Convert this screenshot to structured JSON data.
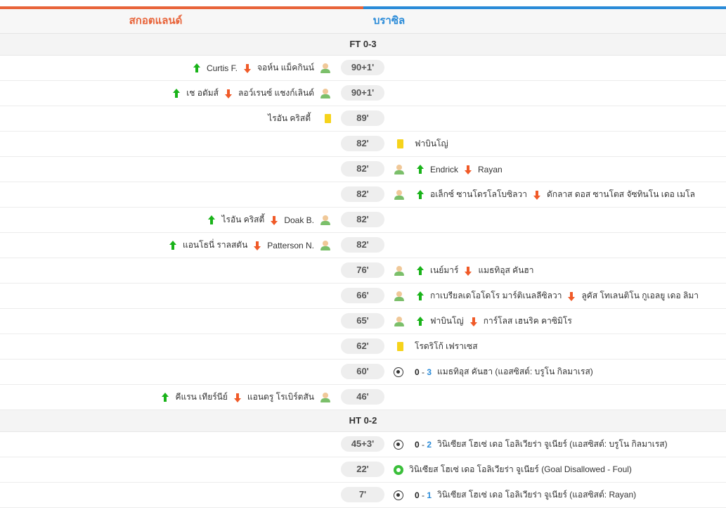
{
  "colors": {
    "home": "#e8643a",
    "away": "#2a8bd8"
  },
  "teams": {
    "home": "สกอตแลนด์",
    "away": "บราซิล"
  },
  "score_rows": [
    {
      "label": "FT 0-3"
    },
    {
      "label": "HT 0-2"
    }
  ],
  "events": [
    {
      "minute": "90+1'",
      "side": "home",
      "type": "sub",
      "in": "Curtis F.",
      "out": "จอห์น แม็คกินน์"
    },
    {
      "minute": "90+1'",
      "side": "home",
      "type": "sub",
      "in": "เช อดัมส์",
      "out": "ลอว์เรนซ์ แชงก์เลินด์"
    },
    {
      "minute": "89'",
      "side": "home",
      "type": "yellow",
      "player": "ไรอัน คริสตี้"
    },
    {
      "minute": "82'",
      "side": "away",
      "type": "yellow",
      "player": "ฟาบินโญ่"
    },
    {
      "minute": "82'",
      "side": "away",
      "type": "sub",
      "in": "Endrick",
      "out": "Rayan"
    },
    {
      "minute": "82'",
      "side": "away",
      "type": "sub",
      "in": "อเล็กซ์ ซานโดรโลโบซิลวา",
      "out": "ดักลาส ดอส ซานโตส จัซทินโน เดอ เมโล"
    },
    {
      "minute": "82'",
      "side": "home",
      "type": "sub",
      "in": "ไรอัน คริสตี้",
      "out": "Doak B."
    },
    {
      "minute": "82'",
      "side": "home",
      "type": "sub",
      "in": "แอนโธนี่ ราลสตัน",
      "out": "Patterson N."
    },
    {
      "minute": "76'",
      "side": "away",
      "type": "sub",
      "in": "เนย์มาร์",
      "out": "แมธทิอุส คันฮา"
    },
    {
      "minute": "66'",
      "side": "away",
      "type": "sub",
      "in": "กาเบรียลเดโอโดโร มาร์ติเนลลีซิลวา",
      "out": "ลูคัส โทเลนติโน กูเอลยู เดอ ลิมา"
    },
    {
      "minute": "65'",
      "side": "away",
      "type": "sub",
      "in": "ฟาบินโญ่",
      "out": "การ์โลส เฮนริค คาซิมิโร"
    },
    {
      "minute": "62'",
      "side": "away",
      "type": "yellow",
      "player": "โรดริโก้ เฟราเซส"
    },
    {
      "minute": "60'",
      "side": "away",
      "type": "goal",
      "score_home": "0",
      "score_away": "3",
      "text": "แมธทิอุส คันฮา (แอสซิสต์: บรูโน กิลมาเรส)"
    },
    {
      "minute": "46'",
      "side": "home",
      "type": "sub",
      "in": "คีแรน เทียร์นีย์",
      "out": "แอนดรู โรเบิร์ตสัน"
    },
    {
      "minute": "45+3'",
      "side": "away",
      "type": "goal",
      "score_home": "0",
      "score_away": "2",
      "text": "วินิเซียส โฮเซ่ เดอ โอลิเวียร่า จูเนียร์ (แอสซิสต์: บรูโน กิลมาเรส)"
    },
    {
      "minute": "22'",
      "side": "away",
      "type": "var",
      "text": "วินิเซียส โฮเซ่ เดอ โอลิเวียร่า จูเนียร์ (Goal Disallowed - Foul)"
    },
    {
      "minute": "7'",
      "side": "away",
      "type": "goal",
      "score_home": "0",
      "score_away": "1",
      "text": "วินิเซียส โฮเซ่ เดอ โอลิเวียร่า จูเนียร์ (แอสซิสต์: Rayan)"
    }
  ]
}
